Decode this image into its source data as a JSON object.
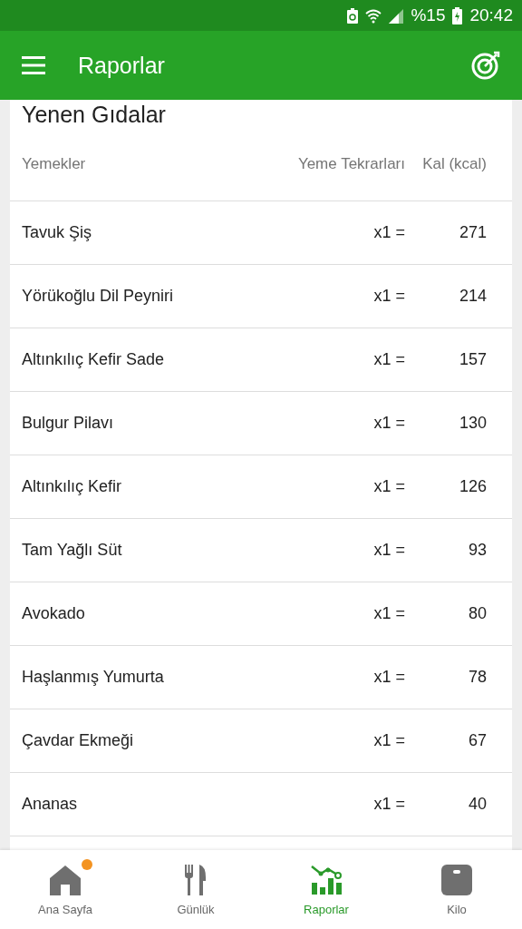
{
  "status_bar": {
    "battery_percent": "%15",
    "time": "20:42"
  },
  "app_bar": {
    "title": "Raporlar"
  },
  "card": {
    "title": "Yenen Gıdalar",
    "columns": [
      "Yemekler",
      "Yeme Tekrarları",
      "Kal (kcal)"
    ],
    "rows": [
      {
        "food": "Tavuk Şiş",
        "count": "x1 =",
        "kcal": "271"
      },
      {
        "food": "Yörükoğlu Dil Peyniri",
        "count": "x1 =",
        "kcal": "214"
      },
      {
        "food": "Altınkılıç Kefir Sade",
        "count": "x1 =",
        "kcal": "157"
      },
      {
        "food": "Bulgur Pilavı",
        "count": "x1 =",
        "kcal": "130"
      },
      {
        "food": "Altınkılıç Kefir",
        "count": "x1 =",
        "kcal": "126"
      },
      {
        "food": "Tam Yağlı Süt",
        "count": "x1 =",
        "kcal": "93"
      },
      {
        "food": "Avokado",
        "count": "x1 =",
        "kcal": "80"
      },
      {
        "food": "Haşlanmış Yumurta",
        "count": "x1 =",
        "kcal": "78"
      },
      {
        "food": "Çavdar Ekmeği",
        "count": "x1 =",
        "kcal": "67"
      },
      {
        "food": "Ananas",
        "count": "x1 =",
        "kcal": "40"
      }
    ]
  },
  "bottom_nav": [
    {
      "kind": "home",
      "label": "Ana Sayfa",
      "selected": false,
      "notification": true
    },
    {
      "kind": "diary",
      "label": "Günlük",
      "selected": false,
      "notification": false
    },
    {
      "kind": "reports",
      "label": "Raporlar",
      "selected": true,
      "notification": false
    },
    {
      "kind": "weight",
      "label": "Kilo",
      "selected": false,
      "notification": false
    }
  ]
}
